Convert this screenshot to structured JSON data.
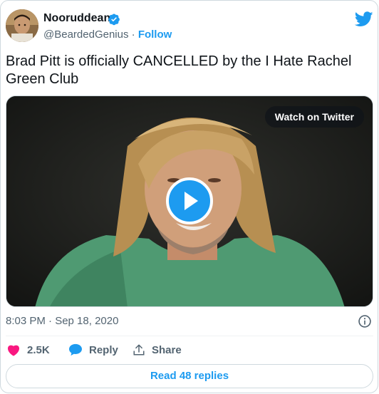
{
  "author": {
    "name": "Nooruddean",
    "handle": "@BeardedGenius",
    "separator": "·",
    "follow_label": "Follow"
  },
  "tweet": {
    "text": "Brad Pitt is officially CANCELLED by the I Hate Rachel Green Club"
  },
  "media": {
    "watch_label": "Watch on Twitter"
  },
  "meta": {
    "timestamp": "8:03 PM · Sep 18, 2020"
  },
  "actions": {
    "likes": "2.5K",
    "reply_label": "Reply",
    "share_label": "Share"
  },
  "footer": {
    "read_replies_label": "Read 48 replies"
  },
  "colors": {
    "accent": "#1d9bf0",
    "like": "#f91880",
    "secondary_text": "#536471"
  },
  "icons": [
    "verified-badge-icon",
    "twitter-bird-icon",
    "play-icon",
    "info-icon",
    "heart-icon",
    "reply-bubble-icon",
    "share-icon"
  ]
}
